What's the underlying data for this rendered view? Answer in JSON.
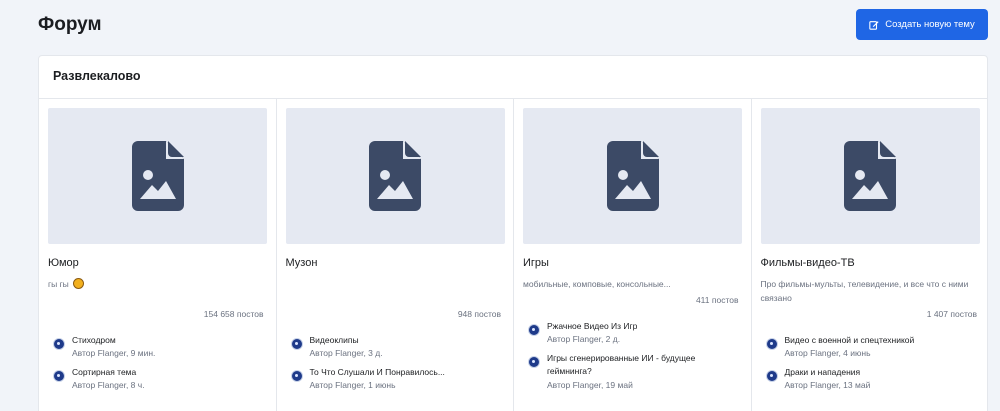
{
  "header": {
    "title": "Форум",
    "create_button_label": "Создать новую тему"
  },
  "section": {
    "title": "Развлекалово",
    "forums": [
      {
        "title": "Юмор",
        "description": "гы гы",
        "description_emoji": "smiley-icon",
        "post_count": "154 658 постов",
        "topics": [
          {
            "title": "Стиходром",
            "meta": "Автор Flanger, 9 мин."
          },
          {
            "title": "Сортирная тема",
            "meta": "Автор Flanger, 8 ч."
          }
        ]
      },
      {
        "title": "Музон",
        "description": "",
        "post_count": "948 постов",
        "topics": [
          {
            "title": "Видеоклипы",
            "meta": "Автор Flanger, 3 д."
          },
          {
            "title": "То Что Слушали И Понравилось...",
            "meta": "Автор Flanger, 1 июнь"
          }
        ]
      },
      {
        "title": "Игры",
        "description": "мобильные, комповые, консольные...",
        "post_count": "411 постов",
        "topics": [
          {
            "title": "Ржачное Видео Из Игр",
            "meta": "Автор Flanger, 2 д."
          },
          {
            "title": "Игры сгенерированные ИИ - будущее геймнинга?",
            "meta": "Автор Flanger, 19 май"
          }
        ]
      },
      {
        "title": "Фильмы-видео-ТВ",
        "description": "Про фильмы-мульты, телевидение, и все что с ними связано",
        "post_count": "1 407 постов",
        "topics": [
          {
            "title": "Видео с военной и спецтехникой",
            "meta": "Автор Flanger, 4 июнь"
          },
          {
            "title": "Драки и нападения",
            "meta": "Автор Flanger, 13 май"
          }
        ]
      }
    ]
  },
  "colors": {
    "accent": "#1f66e5",
    "background": "#f1f4f9",
    "thumb_bg": "#e5e9f2",
    "file_icon": "#3c4a66"
  },
  "icons": {
    "create_button_icon": "edit-icon",
    "thumb_icon": "file-image-icon",
    "avatar_icon": "user-avatar-icon"
  }
}
